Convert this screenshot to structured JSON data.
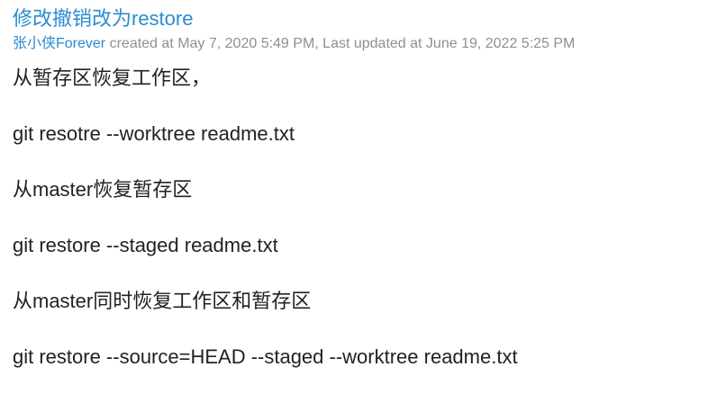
{
  "post": {
    "title": "修改撤销改为restore",
    "author": "张小侠Forever",
    "meta": " created at May 7, 2020 5:49 PM, Last updated at June 19, 2022 5:25 PM",
    "body": [
      "从暂存区恢复工作区，",
      "git resotre --worktree readme.txt",
      "从master恢复暂存区",
      "git restore --staged readme.txt",
      "从master同时恢复工作区和暂存区",
      "git restore --source=HEAD --staged --worktree readme.txt"
    ]
  },
  "colors": {
    "link": "#2a8ccf",
    "meta": "#8f8f8f",
    "text": "#222222"
  }
}
